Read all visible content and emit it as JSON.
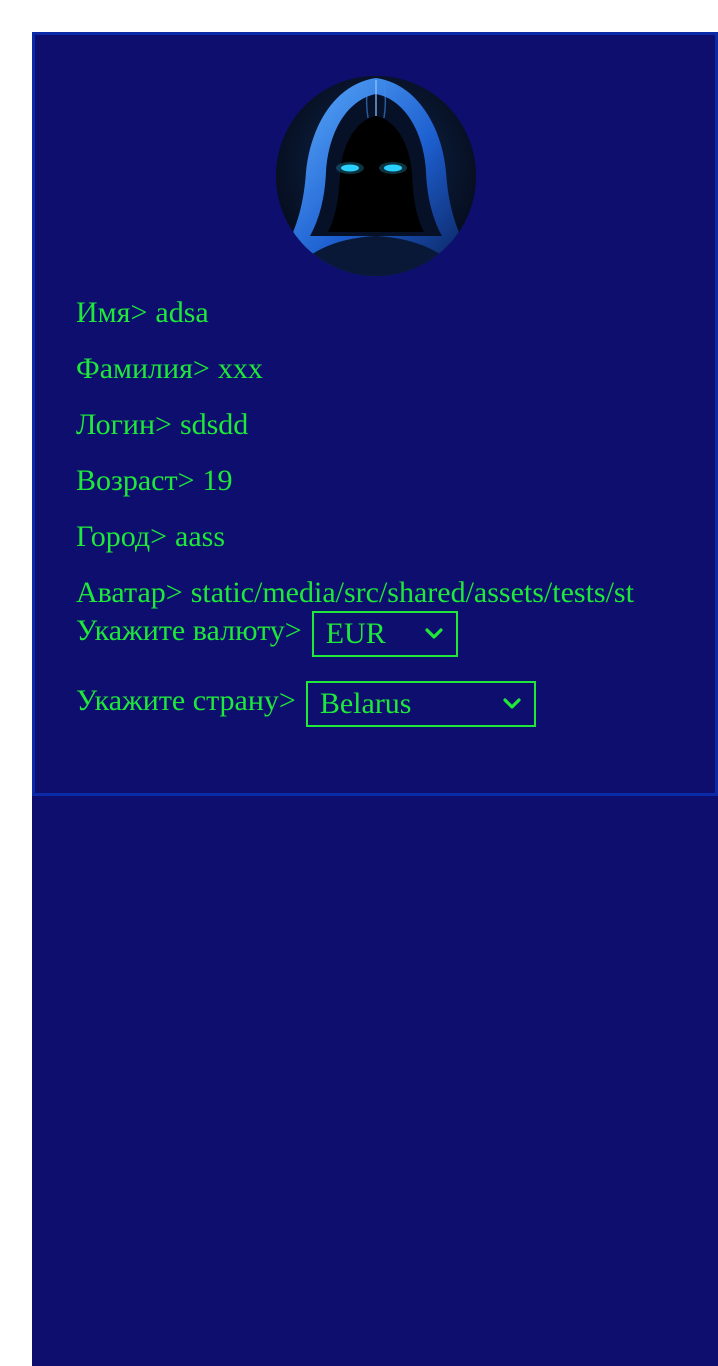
{
  "profile": {
    "avatar_icon": "hooded-figure-avatar",
    "rows": [
      {
        "label": "Имя>",
        "value": "adsa"
      },
      {
        "label": "Фамилия>",
        "value": "xxx"
      },
      {
        "label": "Логин>",
        "value": "sdsdd"
      },
      {
        "label": "Возраст>",
        "value": "19"
      },
      {
        "label": "Город>",
        "value": "aass"
      },
      {
        "label": "Аватар>",
        "value": "static/media/src/shared/assets/tests/st"
      }
    ],
    "currency": {
      "label": "Укажите валюту>",
      "selected": "EUR"
    },
    "country": {
      "label": "Укажите страну>",
      "selected": "Belarus"
    }
  },
  "colors": {
    "background": "#0e0e6e",
    "border": "#0a2aa8",
    "text": "#1ee83a"
  }
}
